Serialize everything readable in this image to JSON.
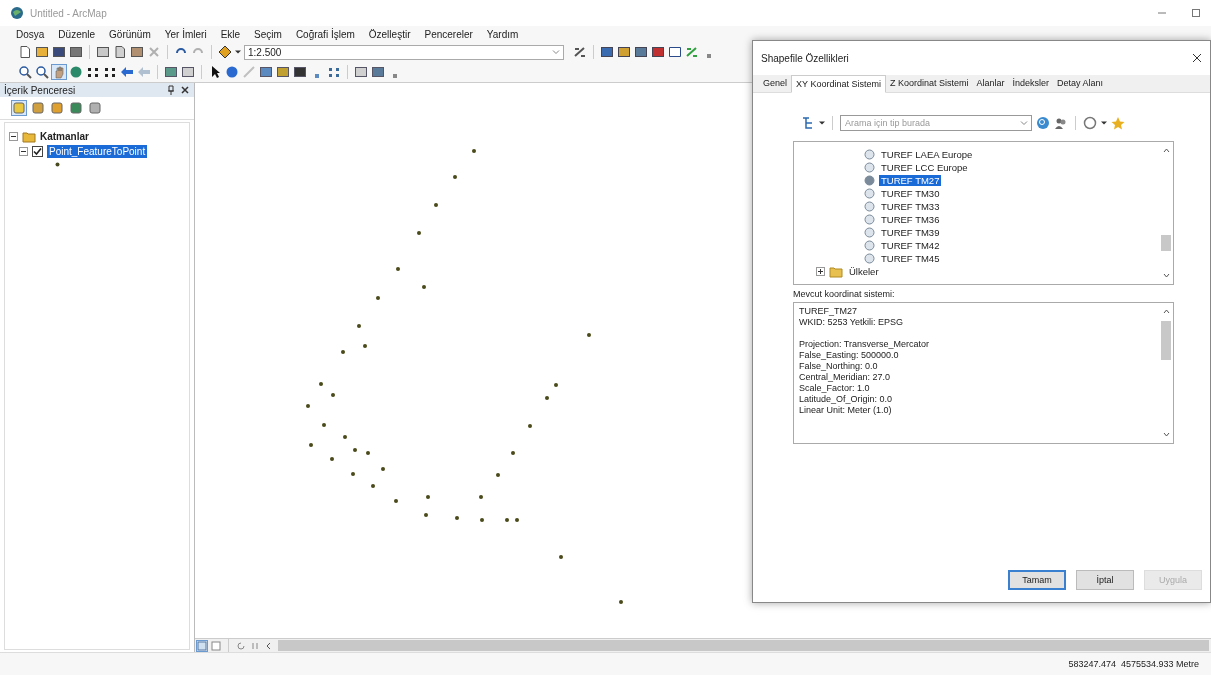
{
  "window": {
    "title": "Untitled - ArcMap"
  },
  "menu": [
    "Dosya",
    "Düzenle",
    "Görünüm",
    "Yer İmleri",
    "Ekle",
    "Seçim",
    "Coğrafi İşlem",
    "Özelleştir",
    "Pencereler",
    "Yardım"
  ],
  "toolbar": {
    "scale": "1:2.500"
  },
  "toc": {
    "title": "İçerik Penceresi",
    "layers": [
      {
        "label": "Katmanlar",
        "expanded": true,
        "children": [
          {
            "label": "Point_FeatureToPoint",
            "checked": true,
            "selected": true
          }
        ]
      }
    ]
  },
  "dialog": {
    "title": "Shapefile Özellikleri",
    "tabs": [
      {
        "label": "Genel",
        "selected": false
      },
      {
        "label": "XY Koordinat Sistemi",
        "selected": true
      },
      {
        "label": "Z Koordinat Sistemi",
        "selected": false
      },
      {
        "label": "Alanlar",
        "selected": false
      },
      {
        "label": "İndeksler",
        "selected": false
      },
      {
        "label": "Detay Alanı",
        "selected": false
      }
    ],
    "search": {
      "placeholder": "Arama için tip burada"
    },
    "tree_items": [
      {
        "label": "TUREF LAEA Europe",
        "kind": "crs",
        "selected": false
      },
      {
        "label": "TUREF LCC Europe",
        "kind": "crs",
        "selected": false
      },
      {
        "label": "TUREF TM27",
        "kind": "crs",
        "selected": true
      },
      {
        "label": "TUREF TM30",
        "kind": "crs",
        "selected": false
      },
      {
        "label": "TUREF TM33",
        "kind": "crs",
        "selected": false
      },
      {
        "label": "TUREF TM36",
        "kind": "crs",
        "selected": false
      },
      {
        "label": "TUREF TM39",
        "kind": "crs",
        "selected": false
      },
      {
        "label": "TUREF TM42",
        "kind": "crs",
        "selected": false
      },
      {
        "label": "TUREF TM45",
        "kind": "crs",
        "selected": false
      },
      {
        "label": "Ülkeler",
        "kind": "folder",
        "selected": false
      }
    ],
    "current_label": "Mevcut koordinat sistemi:",
    "current_text": [
      [
        "TUREF_TM27",
        "WKID: 5253 Yetkili: EPSG"
      ],
      [
        "Projection: Transverse_Mercator",
        "False_Easting: 500000.0",
        "False_Northing: 0.0",
        "Central_Meridian: 27.0",
        "Scale_Factor: 1.0",
        "Latitude_Of_Origin: 0.0",
        "Linear Unit: Meter (1.0)"
      ]
    ],
    "buttons": [
      {
        "label": "Tamam",
        "default": true,
        "disabled": false
      },
      {
        "label": "İptal",
        "default": false,
        "disabled": false
      },
      {
        "label": "Uygula",
        "default": false,
        "disabled": true
      }
    ]
  },
  "status_bar": {
    "coordinates": "583247.474  4575534.933 Metre"
  }
}
